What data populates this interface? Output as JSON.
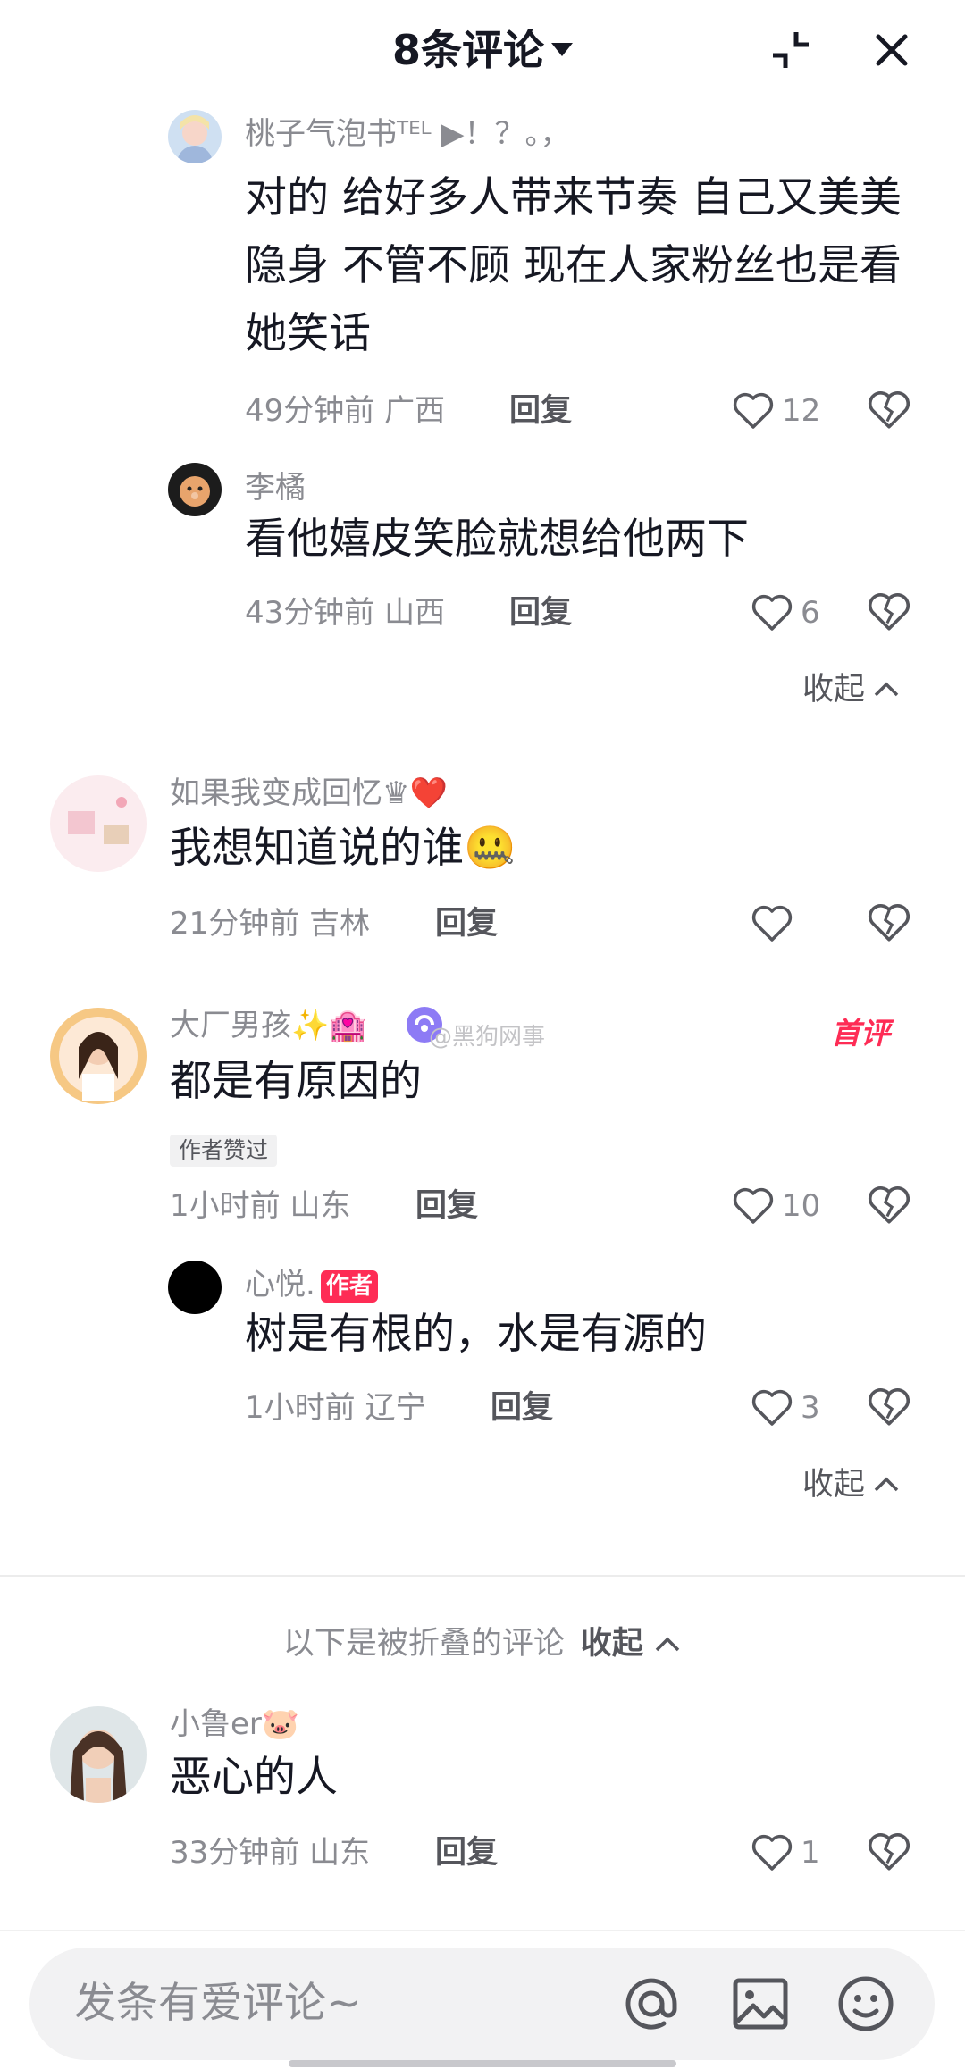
{
  "header": {
    "title": "8条评论",
    "collapse_icon": "collapse-arrows-icon",
    "close_icon": "close-icon"
  },
  "comments": [
    {
      "user": "桃子气泡书ᵀᴱᴸ ▶！？。，",
      "text": "对的 给好多人带来节奏 自己又美美隐身 不管不顾  现在人家粉丝也是看她笑话",
      "time": "49分钟前 广西",
      "reply": "回复",
      "likes": "12"
    },
    {
      "user": "李橘",
      "text": "看他嬉皮笑脸就想给他两下",
      "time": "43分钟前 山西",
      "reply": "回复",
      "likes": "6"
    },
    {
      "user": "如果我变成回忆♛❤️",
      "text": "我想知道说的谁🤐",
      "time": "21分钟前 吉林",
      "reply": "回复",
      "likes": ""
    },
    {
      "user": "大厂男孩✨🏩",
      "watermark": "@黑狗网事",
      "first_badge": "首评",
      "text": "都是有原因的",
      "liked_badge": "作者赞过",
      "time": "1小时前 山东",
      "reply": "回复",
      "likes": "10"
    },
    {
      "user": "心悦.",
      "author_badge": "作者",
      "text": "树是有根的，水是有源的",
      "time": "1小时前 辽宁",
      "reply": "回复",
      "likes": "3"
    },
    {
      "user": "小鲁er🐷",
      "text": "恶心的人",
      "time": "33分钟前 山东",
      "reply": "回复",
      "likes": "1"
    }
  ],
  "collapse_label": "收起",
  "folded": {
    "text": "以下是被折叠的评论",
    "collapse": "收起"
  },
  "input": {
    "placeholder": "发条有爱评论~",
    "icons": [
      "at-icon",
      "image-icon",
      "emoji-icon"
    ]
  },
  "colors": {
    "accent": "#fe2c55",
    "text": "#161823",
    "muted": "#8a8b91"
  }
}
